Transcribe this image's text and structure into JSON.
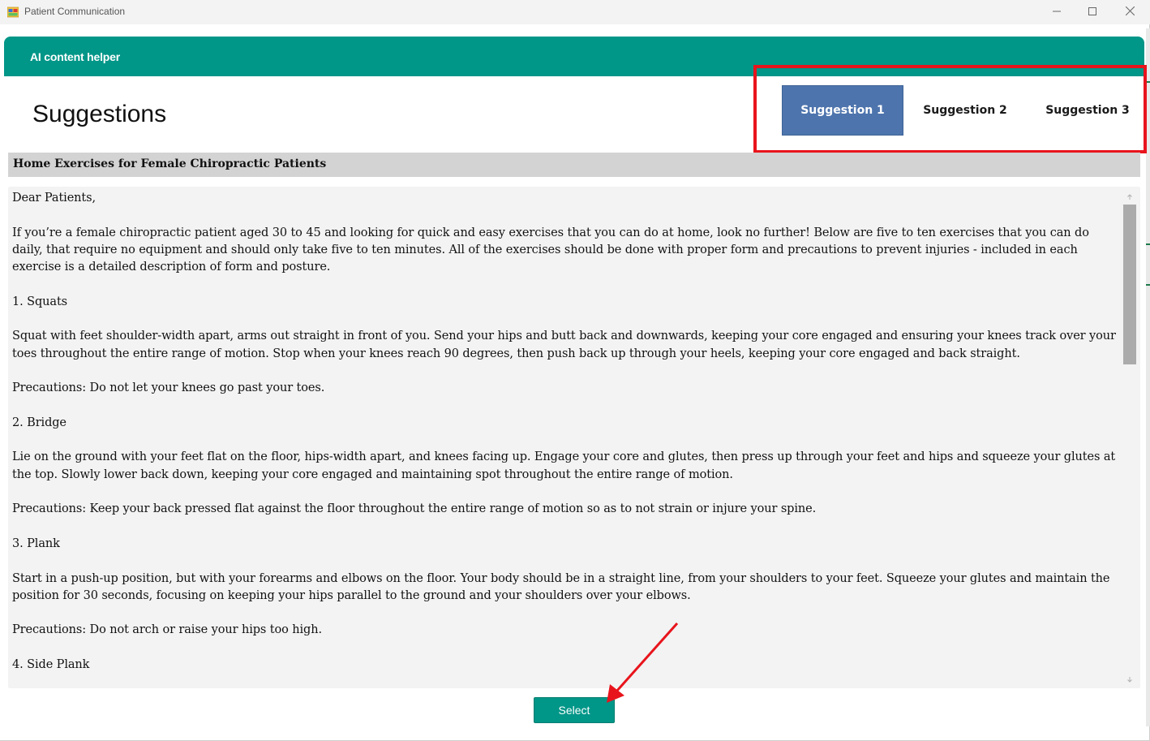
{
  "window": {
    "title": "Patient Communication"
  },
  "header": {
    "title": "AI content helper"
  },
  "page": {
    "title": "Suggestions"
  },
  "tabs": [
    {
      "label": "Suggestion 1",
      "active": true
    },
    {
      "label": "Suggestion 2",
      "active": false
    },
    {
      "label": "Suggestion 3",
      "active": false
    }
  ],
  "subject": "Home Exercises for Female Chiropractic Patients",
  "body": {
    "paragraphs": [
      "Dear Patients,",
      "If you’re a female chiropractic patient aged 30 to 45 and looking for quick and easy exercises that you can do at home, look no further! Below are five to ten exercises that you can do daily, that require no equipment and should only take five to ten minutes. All of the exercises should be done with proper form and precautions to prevent injuries - included in each exercise is a detailed description of form and posture.",
      "1. Squats",
      "Squat with feet shoulder-width apart, arms out straight in front of you. Send your hips and butt back and downwards, keeping your core engaged and ensuring your knees track over your toes throughout the entire range of motion. Stop when your knees reach 90 degrees, then push back up through your heels, keeping your core engaged and back straight.",
      "Precautions: Do not let your knees go past your toes.",
      "2. Bridge",
      "Lie on the ground with your feet flat on the floor, hips-width apart, and knees facing up. Engage your core and glutes, then press up through your feet and hips and squeeze your glutes at the top. Slowly lower back down, keeping your core engaged and maintaining spot throughout the entire range of motion.",
      "Precautions: Keep your back pressed flat against the floor throughout the entire range of motion so as to not strain or injure your spine.",
      "3. Plank",
      "Start in a push-up position, but with your forearms and elbows on the floor. Your body should be in a straight line, from your shoulders to your feet. Squeeze your glutes and maintain the position for 30 seconds, focusing on keeping your hips parallel to the ground and your shoulders over your elbows.",
      "Precautions: Do not arch or raise your hips too high.",
      "4. Side Plank"
    ]
  },
  "actions": {
    "select_label": "Select"
  },
  "colors": {
    "header_teal": "#009688",
    "active_tab": "#4d74ad",
    "annotation_red": "#e8141c"
  },
  "icons": {
    "app": "app-window-icon",
    "minimize": "minimize-icon",
    "maximize": "maximize-icon",
    "close": "close-icon"
  }
}
